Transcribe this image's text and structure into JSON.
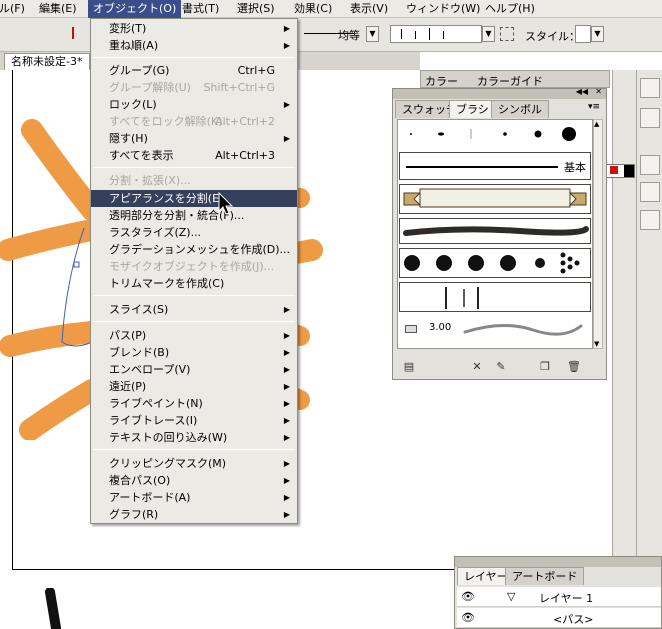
{
  "menubar": {
    "items": [
      "ル(F)",
      "編集(E)",
      "オブジェクト(O)",
      "書式(T)",
      "選択(S)",
      "効果(C)",
      "表示(V)",
      "ウィンドウ(W)",
      "ヘルプ(H)"
    ]
  },
  "controlbar": {
    "stroke_label": "均等",
    "style_label": "スタイル："
  },
  "document": {
    "tab_title": "名称未設定-3*"
  },
  "object_menu": {
    "items": [
      {
        "label": "変形(T)",
        "shortcut": "",
        "submenu": true,
        "disabled": false
      },
      {
        "label": "重ね順(A)",
        "shortcut": "",
        "submenu": true,
        "disabled": false
      },
      {
        "label": "グループ(G)",
        "shortcut": "Ctrl+G",
        "submenu": false,
        "disabled": false
      },
      {
        "label": "グループ解除(U)",
        "shortcut": "Shift+Ctrl+G",
        "submenu": false,
        "disabled": true
      },
      {
        "label": "ロック(L)",
        "shortcut": "",
        "submenu": true,
        "disabled": false
      },
      {
        "label": "すべてをロック解除(K)",
        "shortcut": "Alt+Ctrl+2",
        "submenu": false,
        "disabled": true
      },
      {
        "label": "隠す(H)",
        "shortcut": "",
        "submenu": true,
        "disabled": false
      },
      {
        "label": "すべてを表示",
        "shortcut": "Alt+Ctrl+3",
        "submenu": false,
        "disabled": false
      },
      {
        "label": "分割・拡張(X)...",
        "shortcut": "",
        "submenu": false,
        "disabled": true
      },
      {
        "label": "アピアランスを分割(E)",
        "shortcut": "",
        "submenu": false,
        "disabled": false,
        "highlighted": true
      },
      {
        "label": "透明部分を分割・統合(F)...",
        "shortcut": "",
        "submenu": false,
        "disabled": false
      },
      {
        "label": "ラスタライズ(Z)...",
        "shortcut": "",
        "submenu": false,
        "disabled": false
      },
      {
        "label": "グラデーションメッシュを作成(D)...",
        "shortcut": "",
        "submenu": false,
        "disabled": false
      },
      {
        "label": "モザイクオブジェクトを作成(J)...",
        "shortcut": "",
        "submenu": false,
        "disabled": true
      },
      {
        "label": "トリムマークを作成(C)",
        "shortcut": "",
        "submenu": false,
        "disabled": false
      },
      {
        "label": "スライス(S)",
        "shortcut": "",
        "submenu": true,
        "disabled": false
      },
      {
        "label": "パス(P)",
        "shortcut": "",
        "submenu": true,
        "disabled": false
      },
      {
        "label": "ブレンド(B)",
        "shortcut": "",
        "submenu": true,
        "disabled": false
      },
      {
        "label": "エンベロープ(V)",
        "shortcut": "",
        "submenu": true,
        "disabled": false
      },
      {
        "label": "遠近(P)",
        "shortcut": "",
        "submenu": true,
        "disabled": false
      },
      {
        "label": "ライブペイント(N)",
        "shortcut": "",
        "submenu": true,
        "disabled": false
      },
      {
        "label": "ライブトレース(I)",
        "shortcut": "",
        "submenu": true,
        "disabled": false
      },
      {
        "label": "テキストの回り込み(W)",
        "shortcut": "",
        "submenu": true,
        "disabled": false
      },
      {
        "label": "クリッピングマスク(M)",
        "shortcut": "",
        "submenu": true,
        "disabled": false
      },
      {
        "label": "複合パス(O)",
        "shortcut": "",
        "submenu": true,
        "disabled": false
      },
      {
        "label": "アートボード(A)",
        "shortcut": "",
        "submenu": true,
        "disabled": false
      },
      {
        "label": "グラフ(R)",
        "shortcut": "",
        "submenu": true,
        "disabled": false
      }
    ]
  },
  "color_panel": {
    "tabs": [
      "カラー",
      "カラーガイド"
    ]
  },
  "brush_panel": {
    "tabs": [
      "スウォッチ",
      "ブラシ",
      "シンボル"
    ],
    "active_tab": "ブラシ",
    "basic_label": "基本",
    "size_value": "3.00"
  },
  "layers_panel": {
    "tabs": [
      "レイヤー",
      "アートボード"
    ],
    "rows": [
      "レイヤー 1",
      "<パス>"
    ]
  },
  "colors": {
    "artwork_orange": "#ef9a45",
    "menu_highlight": "#34405c",
    "menubar_active": "#3a4f8a"
  }
}
